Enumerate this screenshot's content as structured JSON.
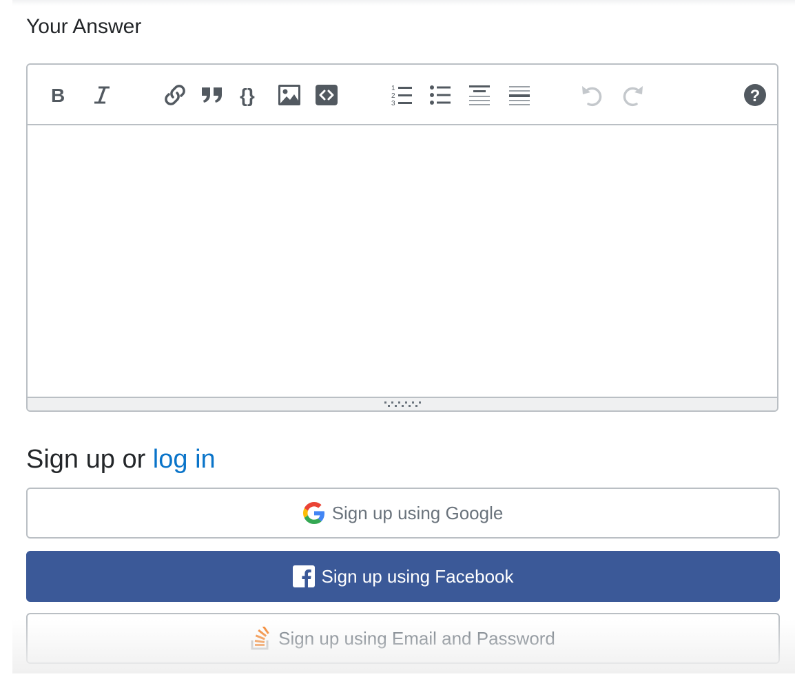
{
  "answer": {
    "title": "Your Answer",
    "editor_value": "",
    "toolbar_icons": [
      "bold-icon",
      "italic-icon",
      "link-icon",
      "blockquote-icon",
      "code-icon",
      "image-icon",
      "snippet-icon",
      "ordered-list-icon",
      "bulleted-list-icon",
      "heading-icon",
      "horizontal-rule-icon",
      "undo-icon",
      "redo-icon",
      "help-icon"
    ]
  },
  "signup": {
    "heading_prefix": "Sign up or ",
    "login_link": "log in",
    "google_label": "Sign up using Google",
    "facebook_label": "Sign up using Facebook",
    "email_label": "Sign up using Email and Password"
  },
  "colors": {
    "link": "#0a74c9",
    "facebook": "#3b5998",
    "stackoverflow_orange": "#f48024",
    "border": "#babfc4",
    "icon": "#525960"
  }
}
